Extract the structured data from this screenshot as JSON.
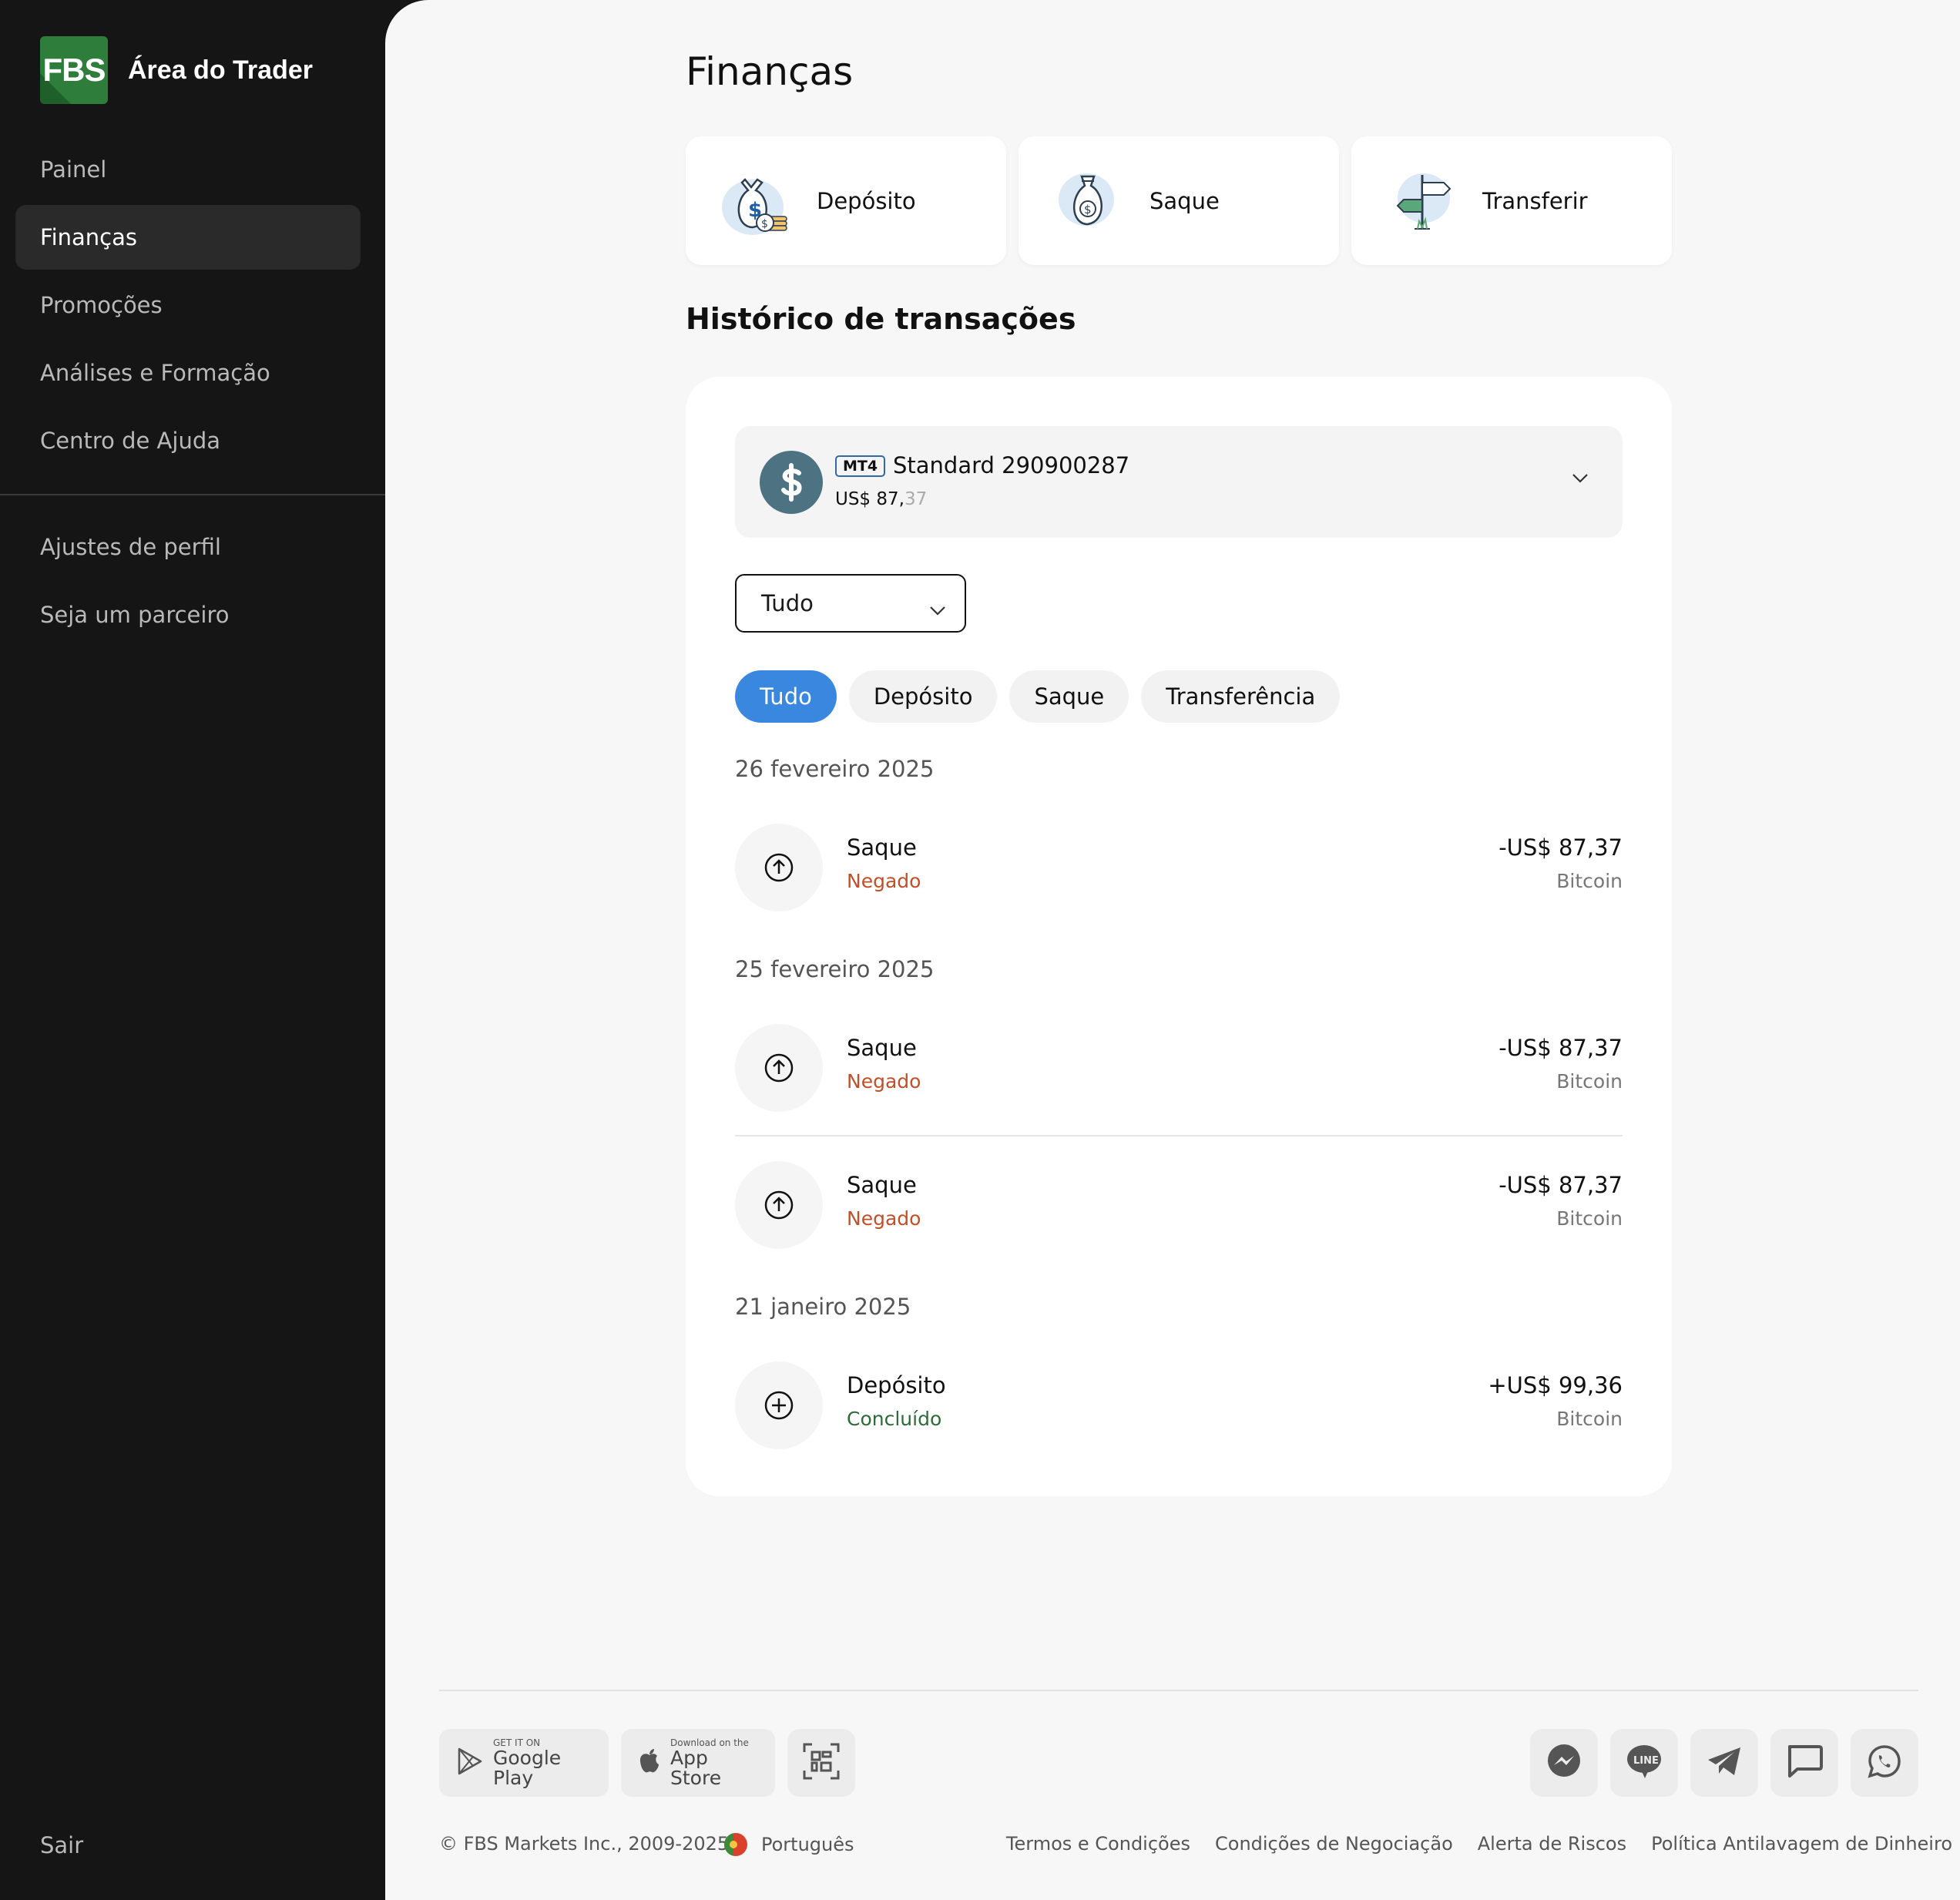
{
  "sidebar": {
    "logo_text": "FBS",
    "brand_title": "Área do Trader",
    "items": [
      {
        "label": "Painel"
      },
      {
        "label": "Finanças"
      },
      {
        "label": "Promoções"
      },
      {
        "label": "Análises e Formação"
      },
      {
        "label": "Centro de Ajuda"
      }
    ],
    "items2": [
      {
        "label": "Ajustes de perfil"
      },
      {
        "label": "Seja um parceiro"
      }
    ],
    "logout": "Sair"
  },
  "main": {
    "title": "Finanças",
    "actions": [
      {
        "label": "Depósito",
        "icon": "money-bag-coins-icon"
      },
      {
        "label": "Saque",
        "icon": "money-bag-icon"
      },
      {
        "label": "Transferir",
        "icon": "signpost-icon"
      }
    ],
    "history_title": "Histórico de transações",
    "account": {
      "badge": "MT4",
      "name": "Standard 290900287",
      "balance_main": "US$ 87,",
      "balance_cents": "37"
    },
    "select": {
      "value": "Tudo"
    },
    "filters": [
      {
        "label": "Tudo"
      },
      {
        "label": "Depósito"
      },
      {
        "label": "Saque"
      },
      {
        "label": "Transferência"
      }
    ],
    "groups": [
      {
        "date": "26 fevereiro 2025"
      },
      {
        "date": "25 fevereiro 2025"
      },
      {
        "date": "21 janeiro 2025"
      }
    ],
    "transactions": [
      {
        "type": "Saque",
        "status": "Negado",
        "amount": "-US$ 87,37",
        "method": "Bitcoin"
      },
      {
        "type": "Saque",
        "status": "Negado",
        "amount": "-US$ 87,37",
        "method": "Bitcoin"
      },
      {
        "type": "Saque",
        "status": "Negado",
        "amount": "-US$ 87,37",
        "method": "Bitcoin"
      },
      {
        "type": "Depósito",
        "status": "Concluído",
        "amount": "+US$ 99,36",
        "method": "Bitcoin"
      }
    ]
  },
  "footer": {
    "google_small": "GET IT ON",
    "google_big": "Google Play",
    "apple_small": "Download on the",
    "apple_big": "App Store",
    "social_line": "LINE",
    "copyright": "© FBS Markets Inc., 2009-2025",
    "language": "Português",
    "links": [
      "Termos e Condições",
      "Condições de Negociação",
      "Alerta de Riscos",
      "Política Antilavagem de Dinheiro"
    ]
  },
  "colors": {
    "accent": "#3a87e0",
    "brand_green": "#2e7d3a",
    "denied": "#c0502a",
    "completed": "#2e6a3a"
  }
}
